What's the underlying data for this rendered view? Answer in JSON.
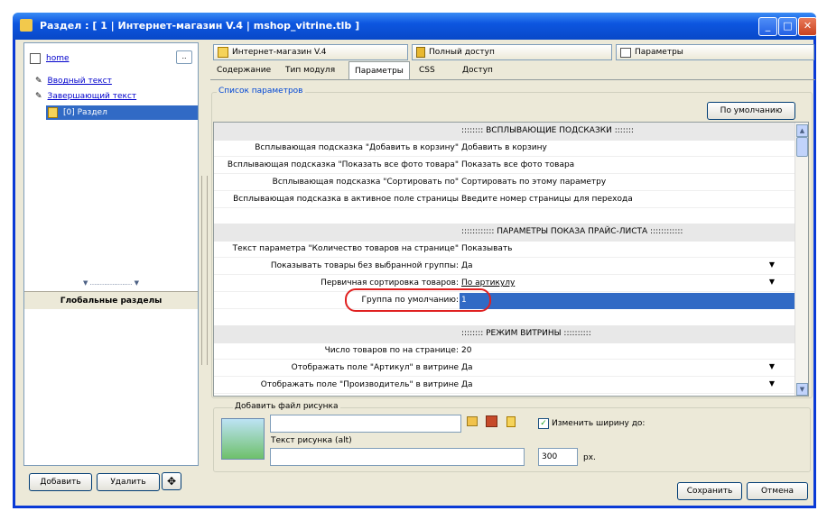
{
  "window": {
    "title": "Раздел : [ 1 | Интернет-магазин V.4 | mshop_vitrine.tlb ]",
    "minimize": "_",
    "maximize": "□",
    "close": "✕"
  },
  "left": {
    "home": "home",
    "more": "..",
    "items": [
      {
        "label": "Вводный текст"
      },
      {
        "label": "Завершающий текст"
      }
    ],
    "selected": "[0] Раздел",
    "splitter": "▼ ..................... ▼",
    "global_header": "Глобальные разделы",
    "add": "Добавить",
    "delete": "Удалить",
    "move_icon": "✥"
  },
  "topbar": {
    "module": "Интернет-магазин V.4",
    "access": "Полный доступ",
    "params": "Параметры"
  },
  "tabs": [
    "Содержание",
    "Тип модуля",
    "Параметры",
    "CSS",
    "Доступ"
  ],
  "active_tab": "Параметры",
  "params": {
    "legend": "Список параметров",
    "default_button": "По умолчанию",
    "section1": ":::::::: ВСПЛЫВАЮЩИЕ ПОДСКАЗКИ :::::::",
    "rows1": [
      {
        "label": "Всплывающая подсказка \"Добавить в корзину\"",
        "value": "Добавить в корзину"
      },
      {
        "label": "Всплывающая подсказка \"Показать все фото товара\"",
        "value": "Показать все фото товара"
      },
      {
        "label": "Всплывающая подсказка \"Сортировать по\"",
        "value": "Сортировать по этому параметру"
      },
      {
        "label": "Всплывающая подсказка в активное поле страницы",
        "value": "Введите номер страницы для перехода"
      }
    ],
    "section2": ":::::::::::: ПАРАМЕТРЫ ПОКАЗА ПРАЙС-ЛИСТА ::::::::::::",
    "rows2": [
      {
        "label": "Текст параметра \"Количество товаров на странице\"",
        "value": "Показывать"
      },
      {
        "label": "Показывать товары без выбранной группы:",
        "value": "Да"
      },
      {
        "label": "Первичная сортировка товаров:",
        "value": "По артикулу"
      },
      {
        "label": "Группа по умолчанию:",
        "value": "1"
      }
    ],
    "section3": ":::::::: РЕЖИМ ВИТРИНЫ ::::::::::",
    "rows3": [
      {
        "label": "Число товаров по на странице:",
        "value": "20"
      },
      {
        "label": "Отображать поле \"Артикул\" в витрине",
        "value": "Да"
      },
      {
        "label": "Отображать поле \"Производитель\" в витрине",
        "value": "Да"
      }
    ]
  },
  "image_box": {
    "legend": "Добавить файл рисунка",
    "alt_label": "Текст рисунка (alt)",
    "resize_label": "Изменить ширину до:",
    "width_value": "300",
    "unit": "px."
  },
  "footer": {
    "save": "Сохранить",
    "cancel": "Отмена"
  }
}
